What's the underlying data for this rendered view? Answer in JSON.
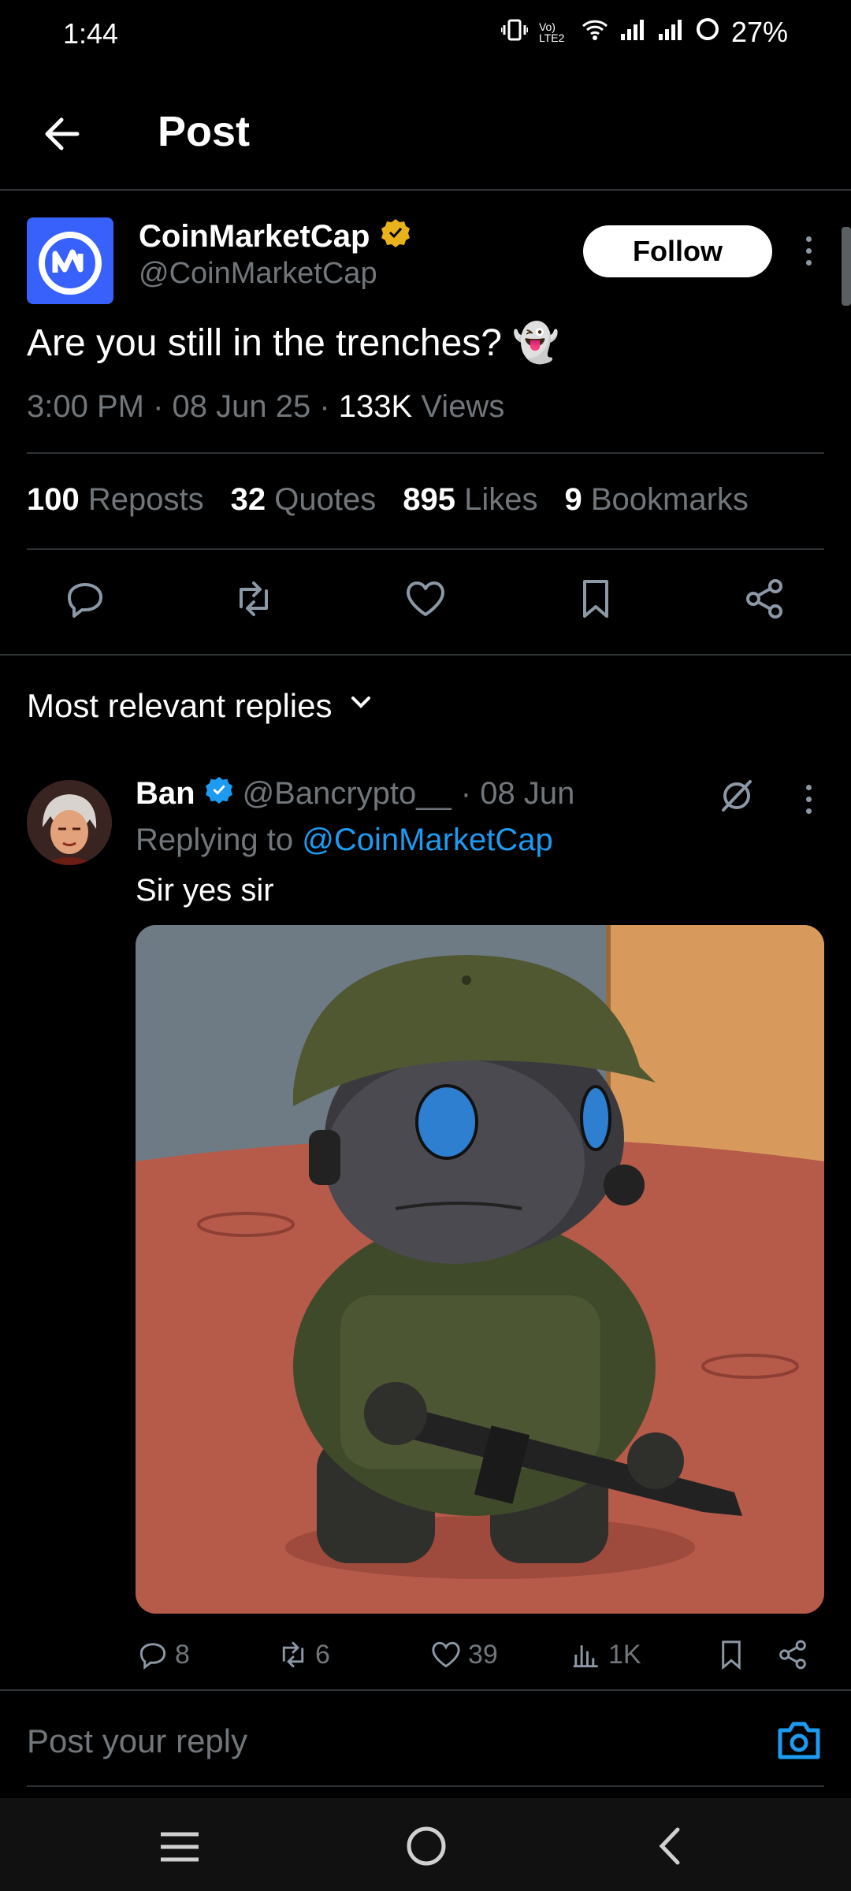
{
  "status_bar": {
    "time": "1:44",
    "battery": "27%",
    "network": "Vo) LTE2"
  },
  "top_bar": {
    "title": "Post"
  },
  "post": {
    "author_name": "CoinMarketCap",
    "author_handle": "@CoinMarketCap",
    "follow_label": "Follow",
    "text": "Are you still in the trenches? 👻",
    "time": "3:00 PM",
    "date": "08 Jun 25",
    "views_count": "133K",
    "views_label": "Views",
    "stats": [
      {
        "count": "100",
        "label": "Reposts"
      },
      {
        "count": "32",
        "label": "Quotes"
      },
      {
        "count": "895",
        "label": "Likes"
      },
      {
        "count": "9",
        "label": "Bookmarks"
      }
    ]
  },
  "replies_header": "Most relevant replies",
  "reply": {
    "name": "Ban",
    "handle": "@Bancrypto__",
    "date": "· 08 Jun",
    "replying_prefix": "Replying to",
    "replying_to": "@CoinMarketCap",
    "text": "Sir yes sir",
    "counts": {
      "replies": "8",
      "reposts": "6",
      "likes": "39",
      "views": "1K"
    }
  },
  "reply_box": {
    "placeholder": "Post your reply"
  },
  "colors": {
    "accent": "#1d9bf0",
    "gold": "#e8b21a",
    "cmc_blue": "#3861fb"
  }
}
